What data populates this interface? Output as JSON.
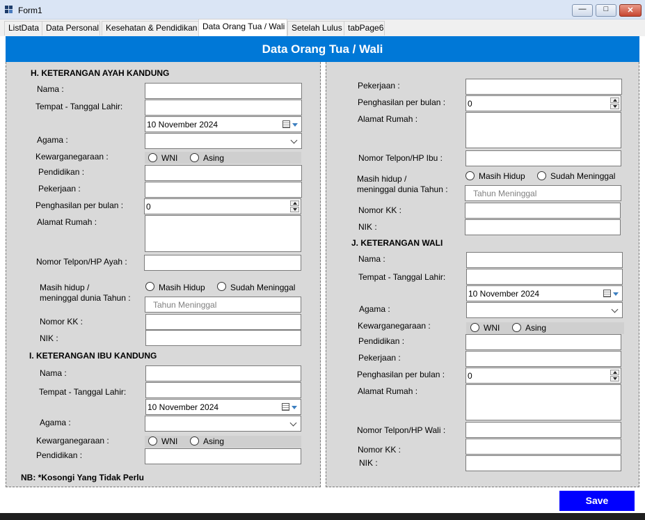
{
  "window": {
    "title": "Form1",
    "minimize_glyph": "—",
    "maximize_glyph": "□",
    "close_glyph": "✕"
  },
  "tabs": [
    "ListData",
    "Data Personal",
    "Kesehatan & Pendidikan",
    "Data Orang Tua / Wali",
    "Setelah Lulus",
    "tabPage6"
  ],
  "active_tab": "Data Orang Tua / Wali",
  "header": {
    "title": "Data Orang Tua / Wali"
  },
  "ayah": {
    "section_title": "H.  KETERANGAN AYAH KANDUNG",
    "nama_label": "Nama :",
    "ttl_label": "Tempat - Tanggal Lahir:",
    "tanggal_value": "10 November 2024",
    "agama_label": "Agama :",
    "kewarganegaraan_label": "Kewarganegaraan :",
    "wni_label": "WNI",
    "asing_label": "Asing",
    "pendidikan_label": "Pendidikan :",
    "pekerjaan_label": "Pekerjaan :",
    "penghasilan_label": "Penghasilan per bulan :",
    "penghasilan_value": "0",
    "alamat_label": "Alamat Rumah :",
    "telpon_label": "Nomor Telpon/HP Ayah :",
    "masih_hidup_label_1": "Masih hidup /",
    "masih_hidup_label_2": "meninggal dunia Tahun :",
    "hidup_option": "Masih Hidup",
    "meninggal_option": "Sudah Meninggal",
    "tahun_placeholder": "Tahun Meninggal",
    "kk_label": "Nomor KK  :",
    "nik_label": "NIK :"
  },
  "ibu": {
    "section_title": "I.   KETERANGAN IBU KANDUNG",
    "nama_label": "Nama :",
    "ttl_label": "Tempat - Tanggal Lahir:",
    "tanggal_value": "10 November 2024",
    "agama_label": "Agama :",
    "kewarganegaraan_label": "Kewarganegaraan :",
    "wni_label": "WNI",
    "asing_label": "Asing",
    "pendidikan_label": "Pendidikan :",
    "pekerjaan_label": "Pekerjaan :",
    "penghasilan_label": "Penghasilan per bulan :",
    "penghasilan_value": "0",
    "alamat_label": "Alamat Rumah :",
    "telpon_label": "Nomor Telpon/HP Ibu :",
    "masih_hidup_label_1": "Masih hidup /",
    "masih_hidup_label_2": "meninggal dunia Tahun :",
    "hidup_option": "Masih Hidup",
    "meninggal_option": "Sudah Meninggal",
    "tahun_placeholder": "Tahun Meninggal",
    "kk_label": "Nomor KK  :",
    "nik_label": "NIK :"
  },
  "wali": {
    "section_title": "J.   KETERANGAN WALI",
    "nama_label": "Nama :",
    "ttl_label": "Tempat - Tanggal Lahir:",
    "tanggal_value": "10 November 2024",
    "agama_label": "Agama :",
    "kewarganegaraan_label": "Kewarganegaraan :",
    "wni_label": "WNI",
    "asing_label": "Asing",
    "pendidikan_label": "Pendidikan :",
    "pekerjaan_label": "Pekerjaan :",
    "penghasilan_label": "Penghasilan per bulan :",
    "penghasilan_value": "0",
    "alamat_label": "Alamat Rumah :",
    "telpon_label": "Nomor Telpon/HP Wali :",
    "kk_label": "Nomor KK  :",
    "nik_label": "NIK :"
  },
  "note": "NB: *Kosongi Yang Tidak Perlu",
  "save_label": "Save",
  "colors": {
    "header": "#0078d7",
    "panel": "#d9d9d9",
    "save": "#0000ff"
  }
}
